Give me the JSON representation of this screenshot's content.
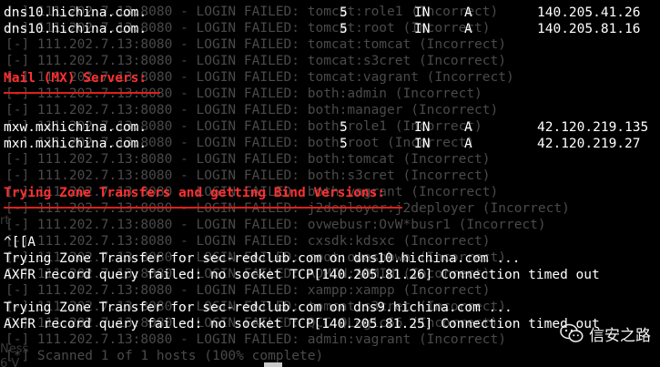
{
  "background_log": [
    "[-] 111.202.7.13:8080 - LOGIN FAILED: tomcat:role1 (Incorrect)",
    "[-] 111.202.7.13:8080 - LOGIN FAILED: tomcat:root (Incorrect)",
    "[-] 111.202.7.13:8080 - LOGIN FAILED: tomcat:tomcat (Incorrect)",
    "[-] 111.202.7.13:8080 - LOGIN FAILED: tomcat:s3cret (Incorrect)",
    "[-] 111.202.7.13:8080 - LOGIN FAILED: tomcat:vagrant (Incorrect)",
    "[-] 111.202.7.13:8080 - LOGIN FAILED: both:admin (Incorrect)",
    "[-] 111.202.7.13:8080 - LOGIN FAILED: both:manager (Incorrect)",
    "[-] 111.202.7.13:8080 - LOGIN FAILED: both:role1 (Incorrect)",
    "[-] 111.202.7.13:8080 - LOGIN FAILED: both:root (Incorrect)",
    "[-] 111.202.7.13:8080 - LOGIN FAILED: both:tomcat (Incorrect)",
    "[-] 111.202.7.13:8080 - LOGIN FAILED: both:s3cret (Incorrect)",
    "[-] 111.202.7.13:8080 - LOGIN FAILED: both:vagrant (Incorrect)",
    "[-] 111.202.7.13:8080 - LOGIN FAILED: j2deployer:j2deployer (Incorrect)",
    "[-] 111.202.7.13:8080 - LOGIN FAILED: ovwebusr:OvW*busr1 (Incorrect)",
    "[-] 111.202.7.13:8080 - LOGIN FAILED: cxsdk:kdsxc (Incorrect)",
    "[-] 111.202.7.13:8080 - LOGIN FAILED: root:owaspbwa (Incorrect)",
    "[-] 111.202.7.13:8080 - LOGIN FAILED: ADMIN:ADMIN (Incorrect)",
    "[-] 111.202.7.13:8080 - LOGIN FAILED: xampp:xampp (Incorrect)",
    "[-] 111.202.7.13:8080 - LOGIN FAILED: tomcat:s3cret (Incorrect)",
    "[-] 111.202.7.13:8080 - LOGIN FAILED: QCC:QLogic66 (Incorrect)",
    "[-] 111.202.7.13:8080 - LOGIN FAILED: admin:vagrant (Incorrect)",
    "[*] Scanned 1 of 1 hosts (100% complete)"
  ],
  "ns_records": [
    {
      "host": "dns10.hichina.com.",
      "ttl": "5",
      "class": "IN",
      "type": "A",
      "ip": "140.205.41.26"
    },
    {
      "host": "dns10.hichina.com.",
      "ttl": "5",
      "class": "IN",
      "type": "A",
      "ip": "140.205.81.16"
    }
  ],
  "mx_heading": "Mail (MX) Servers:",
  "mx_records": [
    {
      "host": "mxw.mxhichina.com.",
      "ttl": "5",
      "class": "IN",
      "type": "A",
      "ip": "42.120.219.135"
    },
    {
      "host": "mxn.mxhichina.com.",
      "ttl": "5",
      "class": "IN",
      "type": "A",
      "ip": "42.120.219.27"
    }
  ],
  "zone_heading": "Trying Zone Transfers and getting Bind Versions:",
  "input_echo": "^[[A",
  "transfers": [
    {
      "attempt": "Trying Zone Transfer for sec-redclub.com on dns10.hichina.com ...",
      "result": "AXFR record query failed: no socket TCP[140.205.81.26] Connection timed out"
    },
    {
      "attempt": "Trying Zone Transfer for sec-redclub.com on dns9.hichina.com ...",
      "result": "AXFR record query failed: no socket TCP[140.205.81.25] Connection timed out"
    }
  ],
  "left_ghost": [
    "rt",
    "Ness",
    "6 V"
  ],
  "watermark": {
    "text": "信安之路",
    "icon": "wechat-icon"
  },
  "colors": {
    "background": "#000000",
    "text": "#ffffff",
    "heading": "#ff3030",
    "underline": "#e0201a",
    "ghost_text": "#4a4a4a"
  }
}
